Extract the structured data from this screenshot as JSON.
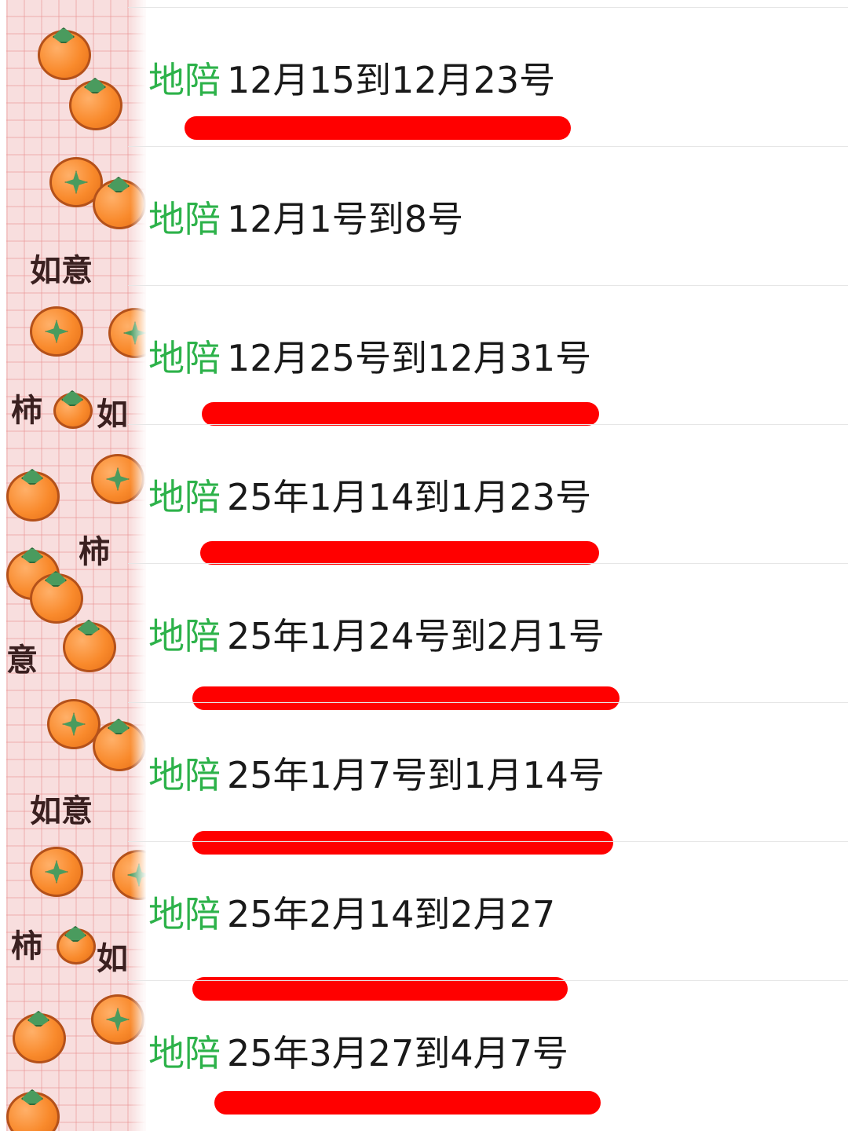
{
  "colors": {
    "tag": "#2db24a",
    "text": "#1a1a1a",
    "highlight": "#ff0000",
    "divider": "#e6e6e6",
    "strip_bg": "#f8dede",
    "persimmon": "#f98a2c"
  },
  "sticker": {
    "texts": [
      "如意",
      "柿",
      "如",
      "意",
      "如意",
      "柿",
      "柿",
      "如"
    ]
  },
  "entries": [
    {
      "tag": "地陪",
      "text": "12月15到12月23号",
      "highlighted": true
    },
    {
      "tag": "地陪",
      "text": "12月1号到8号",
      "highlighted": false
    },
    {
      "tag": "地陪",
      "text": "12月25号到12月31号",
      "highlighted": true
    },
    {
      "tag": "地陪",
      "text": "25年1月14到1月23号",
      "highlighted": true
    },
    {
      "tag": "地陪",
      "text": "25年1月24号到2月1号",
      "highlighted": true
    },
    {
      "tag": "地陪",
      "text": "25年1月7号到1月14号",
      "highlighted": true
    },
    {
      "tag": "地陪",
      "text": "25年2月14到2月27",
      "highlighted": true
    },
    {
      "tag": "地陪",
      "text": "25年3月27到4月7号",
      "highlighted": true
    }
  ]
}
